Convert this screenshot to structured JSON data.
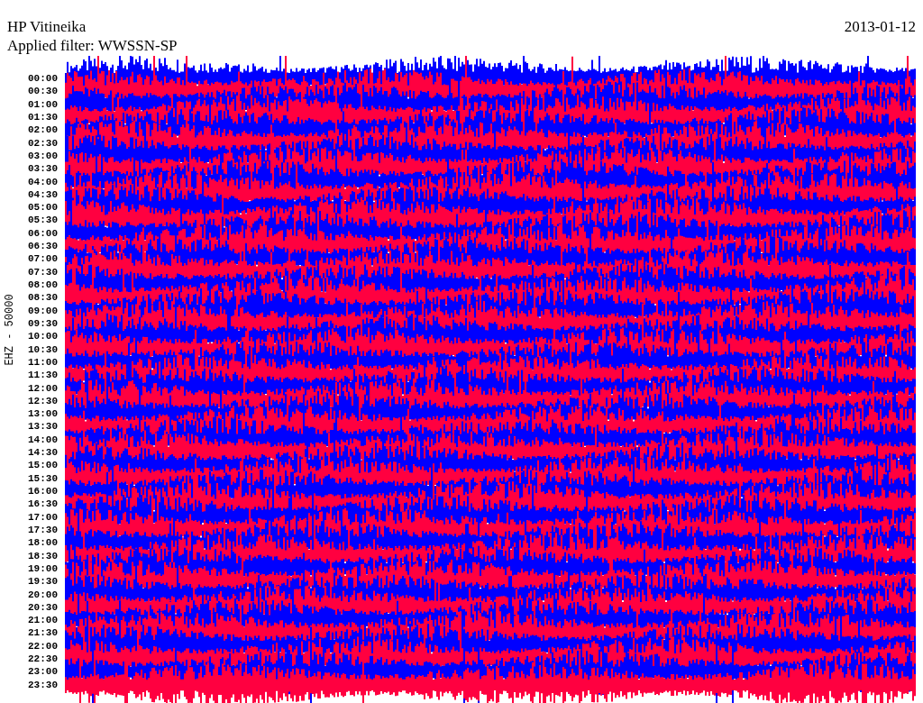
{
  "station": "HP Vitineika",
  "filter": "Applied filter: WWSSN-SP",
  "date": "2013-01-12",
  "channel": "EHZ - 50000",
  "time_labels": [
    "00:00",
    "00:30",
    "01:00",
    "01:30",
    "02:00",
    "02:30",
    "03:00",
    "03:30",
    "04:00",
    "04:30",
    "05:00",
    "05:30",
    "06:00",
    "06:30",
    "07:00",
    "07:30",
    "08:00",
    "08:30",
    "09:00",
    "09:30",
    "10:00",
    "10:30",
    "11:00",
    "11:30",
    "12:00",
    "12:30",
    "13:00",
    "13:30",
    "14:00",
    "14:30",
    "15:00",
    "15:30",
    "16:00",
    "16:30",
    "17:00",
    "17:30",
    "18:00",
    "18:30",
    "19:00",
    "19:30",
    "20:00",
    "20:30",
    "21:00",
    "21:30",
    "22:00",
    "22:30",
    "23:00",
    "23:30"
  ]
}
